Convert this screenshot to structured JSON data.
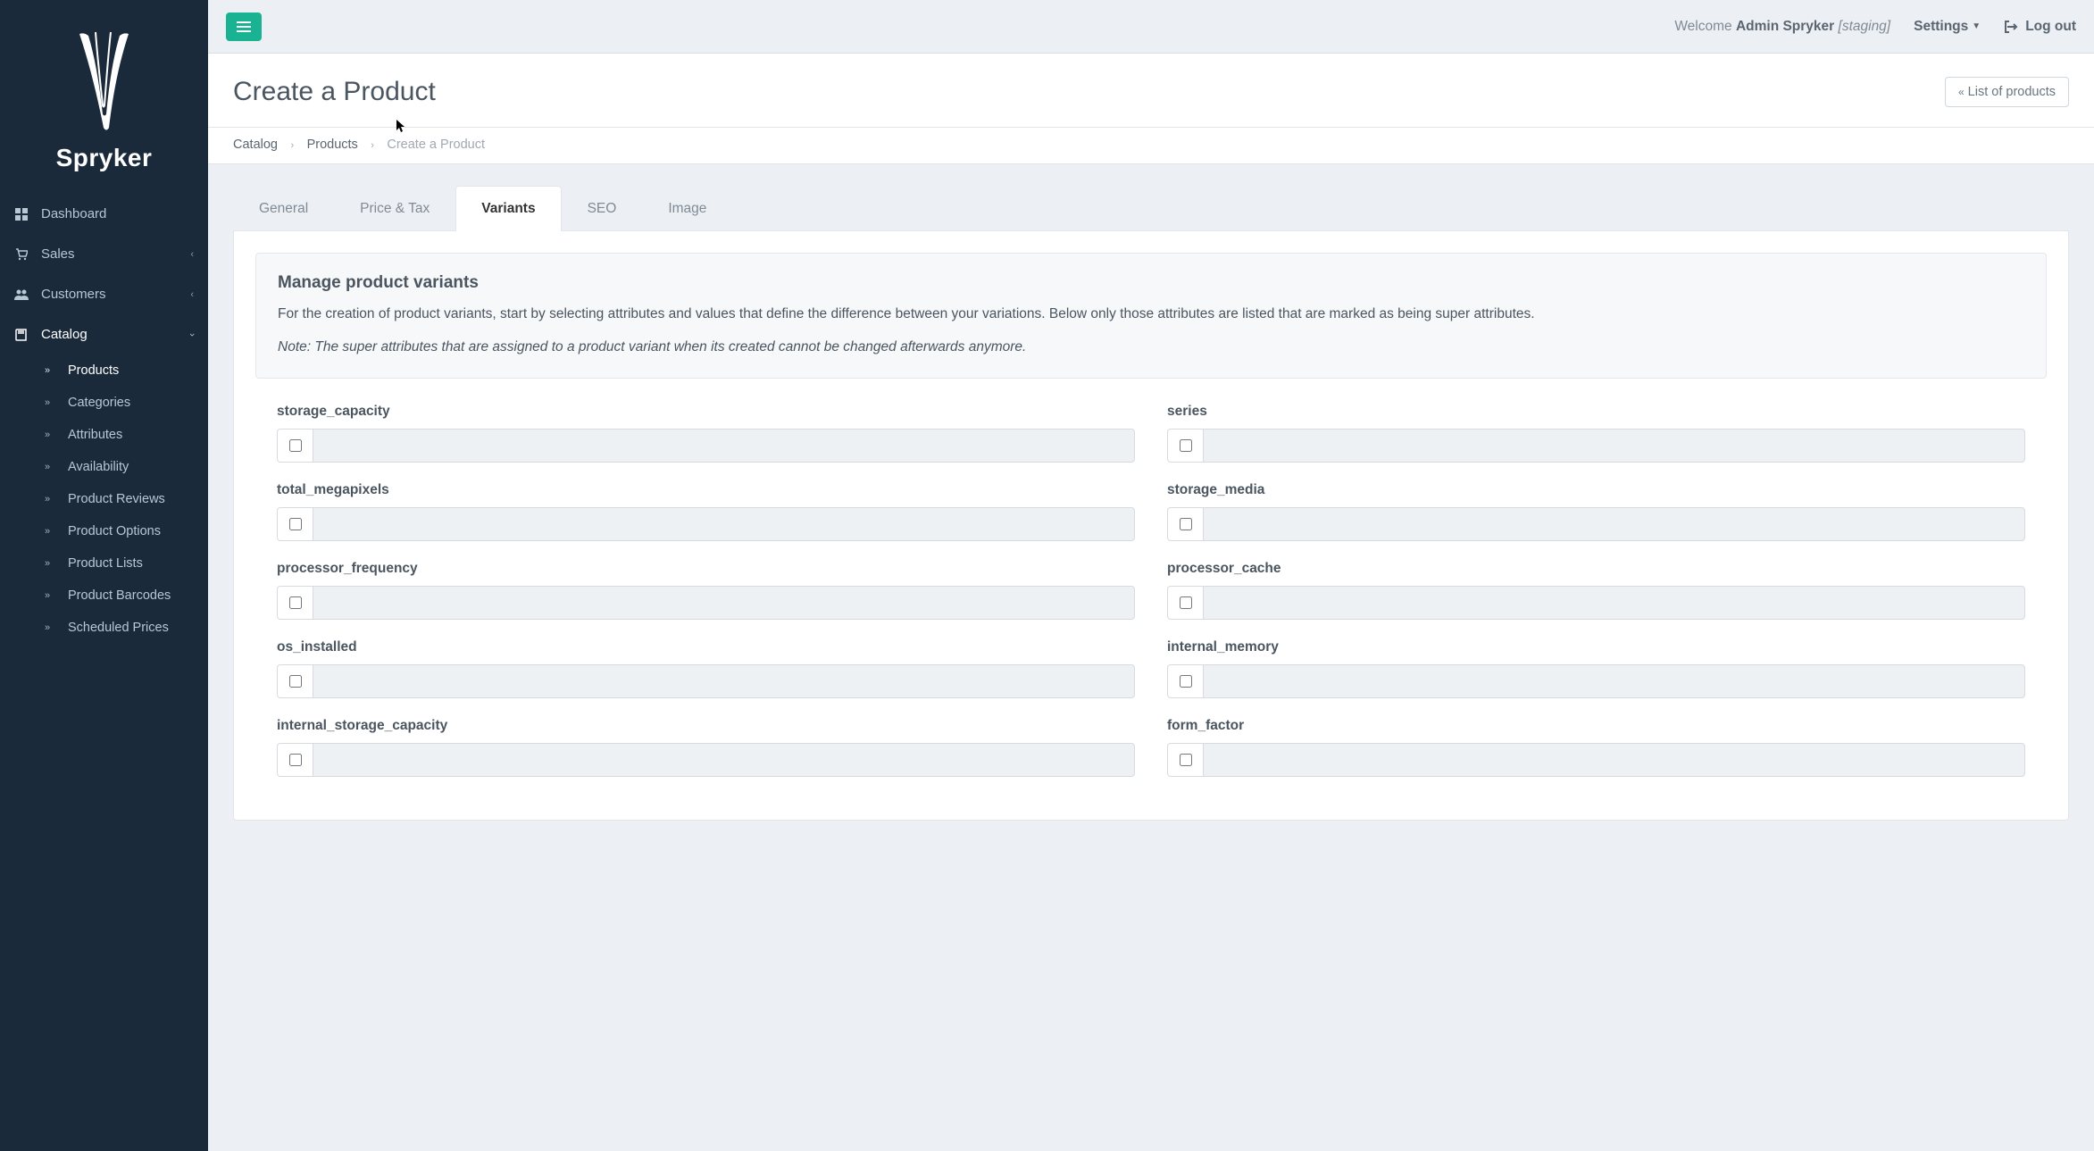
{
  "brand": "Spryker",
  "topbar": {
    "welcome_prefix": "Welcome ",
    "user_name": "Admin Spryker",
    "env_label": "[staging]",
    "settings_label": "Settings",
    "logout_label": "Log out"
  },
  "sidebar": {
    "items": [
      {
        "label": "Dashboard"
      },
      {
        "label": "Sales"
      },
      {
        "label": "Customers"
      },
      {
        "label": "Catalog"
      }
    ],
    "catalog_sub": [
      {
        "label": "Products"
      },
      {
        "label": "Categories"
      },
      {
        "label": "Attributes"
      },
      {
        "label": "Availability"
      },
      {
        "label": "Product Reviews"
      },
      {
        "label": "Product Options"
      },
      {
        "label": "Product Lists"
      },
      {
        "label": "Product Barcodes"
      },
      {
        "label": "Scheduled Prices"
      }
    ]
  },
  "page": {
    "title": "Create a Product",
    "list_button": "List of products",
    "breadcrumbs": {
      "catalog": "Catalog",
      "products": "Products",
      "current": "Create a Product"
    }
  },
  "tabs": [
    {
      "label": "General"
    },
    {
      "label": "Price & Tax"
    },
    {
      "label": "Variants"
    },
    {
      "label": "SEO"
    },
    {
      "label": "Image"
    }
  ],
  "variants": {
    "heading": "Manage product variants",
    "description": "For the creation of product variants, start by selecting attributes and values that define the difference between your variations. Below only those attributes are listed that are marked as being super attributes.",
    "note": "Note: The super attributes that are assigned to a product variant when its created cannot be changed afterwards anymore.",
    "attributes_left": [
      {
        "label": "storage_capacity"
      },
      {
        "label": "total_megapixels"
      },
      {
        "label": "processor_frequency"
      },
      {
        "label": "os_installed"
      },
      {
        "label": "internal_storage_capacity"
      }
    ],
    "attributes_right": [
      {
        "label": "series"
      },
      {
        "label": "storage_media"
      },
      {
        "label": "processor_cache"
      },
      {
        "label": "internal_memory"
      },
      {
        "label": "form_factor"
      }
    ]
  }
}
